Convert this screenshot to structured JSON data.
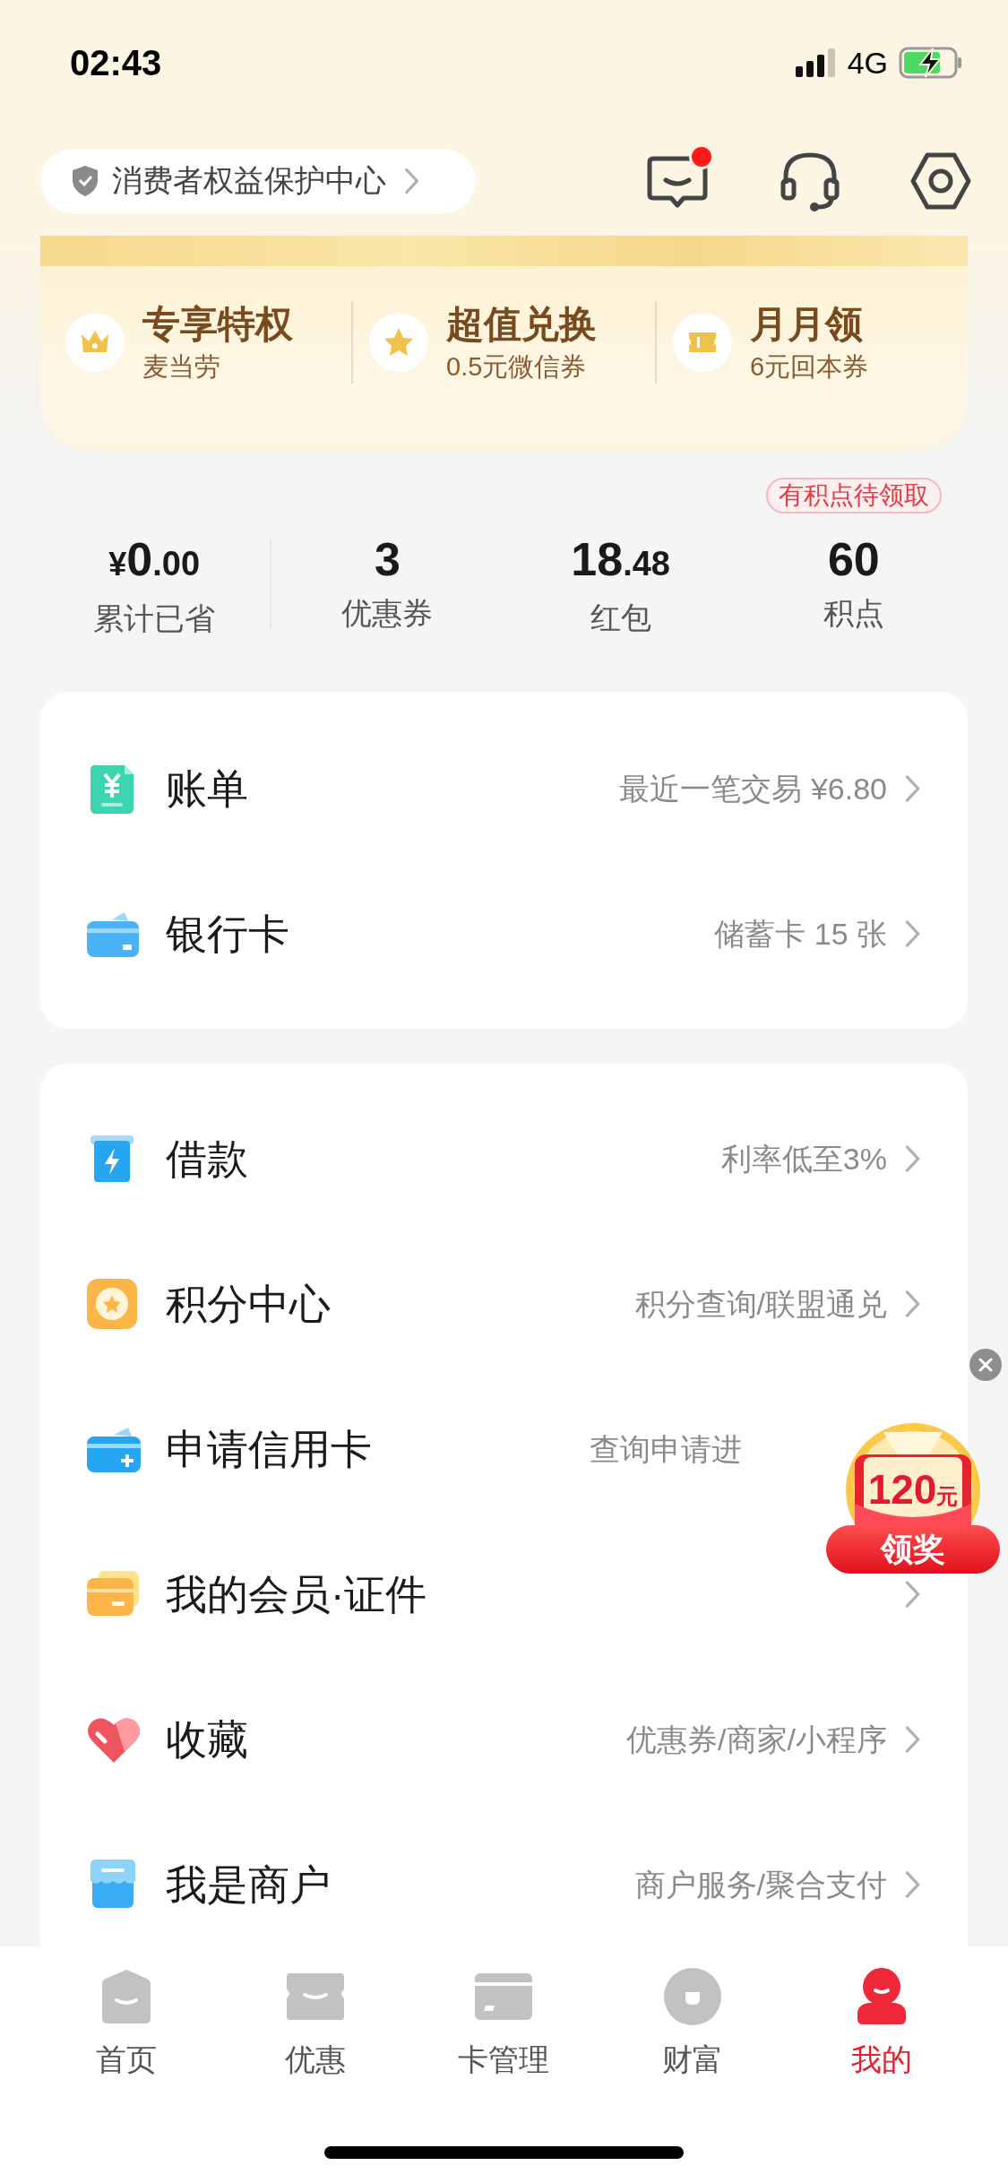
{
  "status_bar": {
    "time": "02:43",
    "network": "4G"
  },
  "header": {
    "protection_link": "消费者权益保护中心",
    "messages": {
      "unread_dot": true
    }
  },
  "perks": [
    {
      "title": "专享特权",
      "subtitle": "麦当劳"
    },
    {
      "title": "超值兑换",
      "subtitle": "0.5元微信券"
    },
    {
      "title": "月月领",
      "subtitle": "6元回本券"
    }
  ],
  "stats": [
    {
      "prefix": "¥",
      "value": "0",
      "decimal": ".00",
      "label": "累计已省"
    },
    {
      "value": "3",
      "label": "优惠券"
    },
    {
      "value": "18",
      "decimal": ".48",
      "label": "红包"
    },
    {
      "value": "60",
      "label": "积点",
      "badge": "有积点待领取"
    }
  ],
  "cards": [
    {
      "rows": [
        {
          "title": "账单",
          "detail": "最近一笔交易 ¥6.80",
          "chevron": true
        },
        {
          "title": "银行卡",
          "detail": "储蓄卡 15 张",
          "chevron": true
        }
      ]
    },
    {
      "rows": [
        {
          "title": "借款",
          "detail": "利率低至3%",
          "chevron": true
        },
        {
          "title": "积分中心",
          "detail": "积分查询/联盟通兑",
          "chevron": true
        },
        {
          "title": "申请信用卡",
          "detail": "查询申请进",
          "chevron": false
        },
        {
          "title": "我的会员·证件",
          "chevron": true
        },
        {
          "title": "收藏",
          "detail": "优惠券/商家/小程序",
          "chevron": true
        },
        {
          "title": "我是商户",
          "detail": "商户服务/聚合支付",
          "chevron": true
        }
      ]
    }
  ],
  "floating_promo": {
    "amount": "120",
    "unit": "元",
    "button": "领奖"
  },
  "tab_bar": [
    {
      "label": "首页",
      "selected": false
    },
    {
      "label": "优惠",
      "selected": false
    },
    {
      "label": "卡管理",
      "selected": false
    },
    {
      "label": "财富",
      "selected": false
    },
    {
      "label": "我的",
      "selected": true
    }
  ]
}
